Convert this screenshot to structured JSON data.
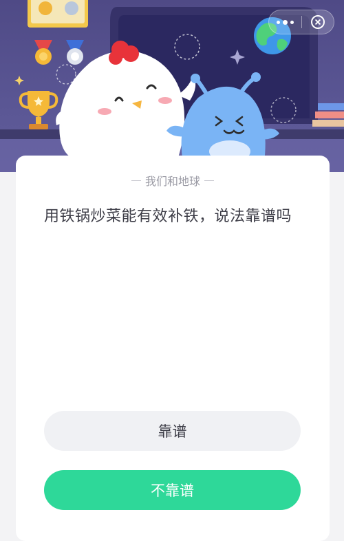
{
  "header": {
    "menu": {
      "more_icon": "more-dots-icon",
      "close_icon": "close-circle-icon"
    }
  },
  "quiz": {
    "category": "我们和地球",
    "question": "用铁锅炒菜能有效补铁，说法靠谱吗",
    "options": [
      {
        "label": "靠谱"
      },
      {
        "label": "不靠谱"
      }
    ]
  },
  "colors": {
    "hero_bg": "#544f8d",
    "accent_green": "#2ed899",
    "option_gray": "#f0f1f4",
    "text_dark": "#3c3c46",
    "text_muted": "#9a9aa4"
  }
}
